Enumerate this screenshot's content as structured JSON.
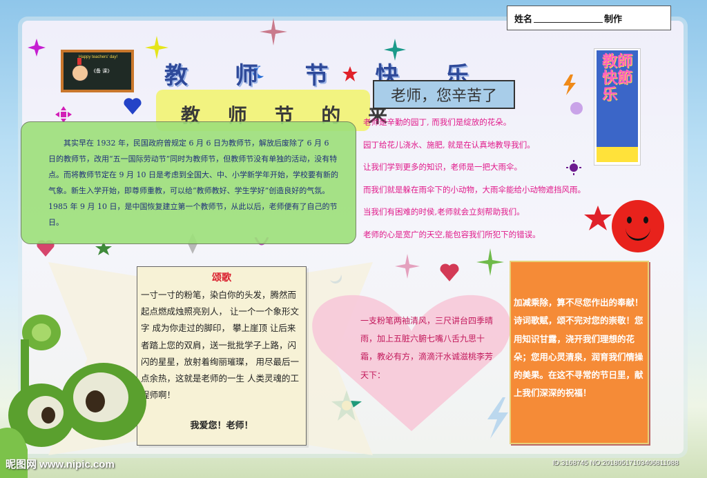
{
  "header": {
    "name_label": "姓名",
    "maker_label": "制作"
  },
  "board": {
    "caption": "Happy teachers' day!",
    "chalk_text": "《备 课》"
  },
  "titles": {
    "main": "教 师 节 快 乐",
    "origin": "教 师 节 的 来",
    "thanks": "老师，您辛苦了",
    "vertical_banner": "教師快節乐"
  },
  "origin_paragraph": "其实早在 1932 年，民国政府曾规定 6 月 6 日为教师节，解放后废除了 6 月 6 日的教师节，改用“五一国际劳动节”同时为教师节，但教师节没有单独的活动，没有特点。而将教师节定在 9 月 10 日是考虑到全国大、中、小学新学年开始，学校要有新的气象。新生入学开始，即尊师重教，可以给“教师教好、学生学好”创造良好的气氛。1985 年 9 月 10 日，是中国恢复建立第一个教师节，从此以后，老师便有了自己的节日。",
  "teacher_lines": [
    "老师是辛勤的园丁, 而我们是绽放的花朵。",
    "园丁给花儿浇水、施肥, 就是在认真地教导我们。",
    "让我们学到更多的知识，老师是一把大雨伞。",
    "而我们就是躲在雨伞下的小动物，大雨伞能给小动物遮挡风雨。",
    "当我们有困难的时侯,老师就会立刻帮助我们。",
    "老师的心是宽广的天空,能包容我们所犯下的错误。"
  ],
  "song": {
    "title": "颂歌",
    "body": "一寸一寸的粉笔，染白你的头发，腾然而起点燃成烛照亮别人， 让一个一个象形文字 成为你走过的脚印， 攀上崖顶 让后来者踏上您的双肩，送一批批学子上路，闪闪的星星，放射着绚丽璀璨， 用尽最后一点余热，这就是老师的一生 人类灵魂的工程师啊！",
    "closing": "我爱您！老师！"
  },
  "poem": "一支粉笔两袖清风，三尺讲台四季晴雨，加上五脏六腑七嘴八舌九思十霜，教必有方，滴滴汗水诚滋桃李芳天下：",
  "blessing": "加减乘除，算不尽您作出的奉献！诗词歌赋，颂不完对您的崇敬！您用知识甘露，浇开我们理想的花朵；您用心灵清泉，润育我们情操的美果。在这不寻常的节日里，献上我们深深的祝福！",
  "watermark": {
    "left": "昵图网 www.nipic.com",
    "right": "ID:3168745 NO:20180517103406811088"
  },
  "colors": {
    "title_blue": "#2f4a9a",
    "origin_green": "#9de07a",
    "pink_text": "#e0198a",
    "orange_box": "#f58b37",
    "heart_pink": "#f7c9d8"
  }
}
